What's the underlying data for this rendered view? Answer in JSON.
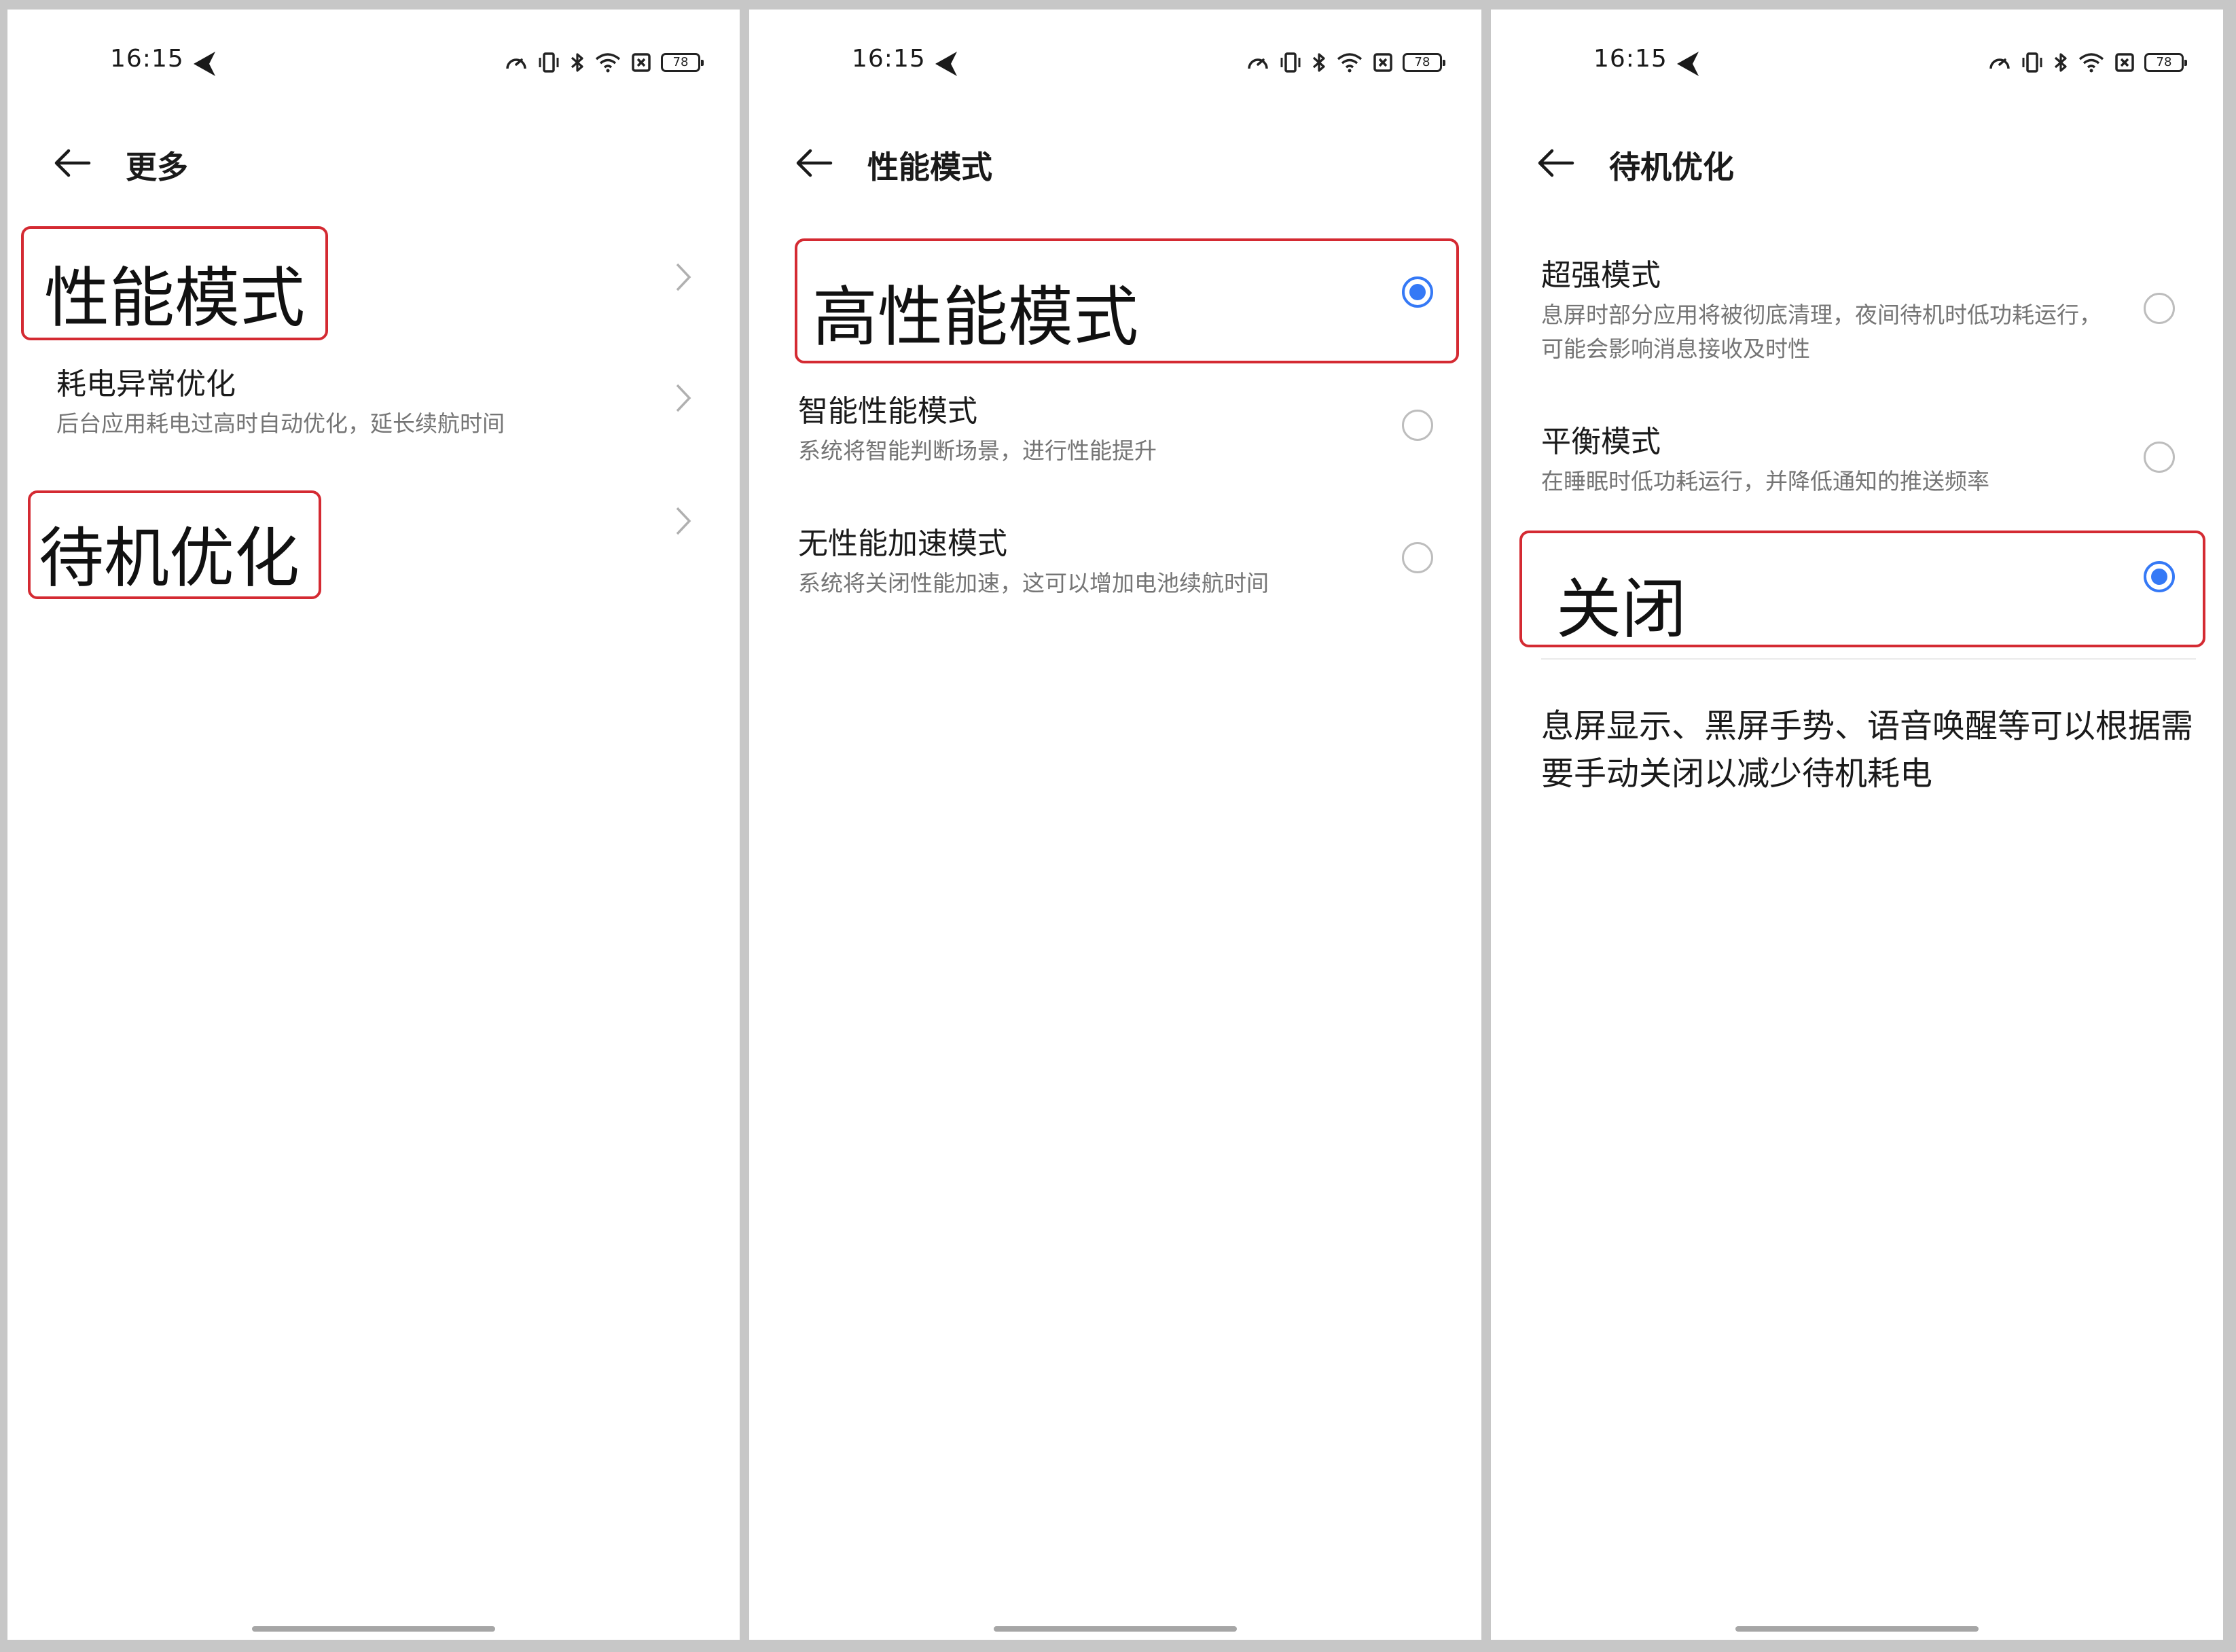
{
  "colors": {
    "accent": "#3579f6",
    "highlight_box": "#d42a32",
    "subtitle": "#757575"
  },
  "status_bar": {
    "time": "16:15",
    "battery": "78"
  },
  "screen1": {
    "title": "更多",
    "items": [
      {
        "title": "性能模式",
        "chevron": true,
        "highlighted": true
      },
      {
        "title": "耗电异常优化",
        "subtitle": "后台应用耗电过高时自动优化，延长续航时间",
        "chevron": true
      },
      {
        "title": "待机优化",
        "chevron": true,
        "highlighted": true
      }
    ]
  },
  "screen2": {
    "title": "性能模式",
    "options": [
      {
        "title": "高性能模式",
        "selected": true,
        "highlighted": true
      },
      {
        "title": "智能性能模式",
        "subtitle": "系统将智能判断场景，进行性能提升",
        "selected": false
      },
      {
        "title": "无性能加速模式",
        "subtitle": "系统将关闭性能加速，这可以增加电池续航时间",
        "selected": false
      }
    ]
  },
  "screen3": {
    "title": "待机优化",
    "options": [
      {
        "title": "超强模式",
        "subtitle": "息屏时部分应用将被彻底清理，夜间待机时低功耗运行，可能会影响消息接收及时性",
        "selected": false
      },
      {
        "title": "平衡模式",
        "subtitle": "在睡眠时低功耗运行，并降低通知的推送频率",
        "selected": false
      },
      {
        "title": "关闭",
        "selected": true,
        "highlighted": true
      }
    ],
    "note": "息屏显示、黑屏手势、语音唤醒等可以根据需要手动关闭以减少待机耗电"
  }
}
